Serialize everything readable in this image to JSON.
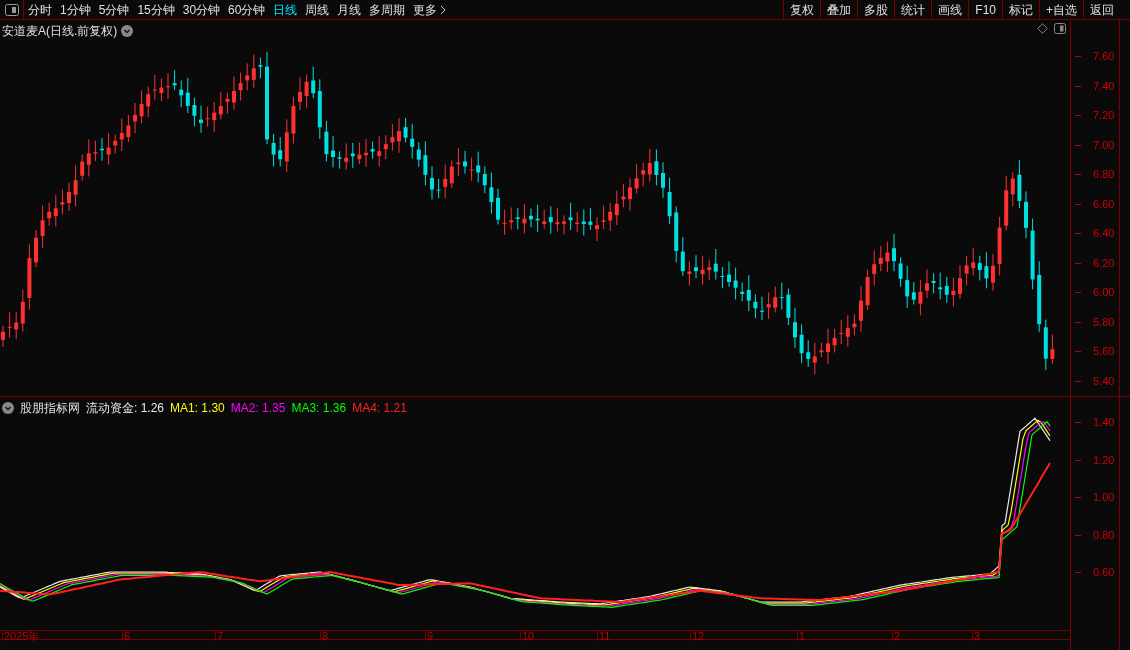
{
  "toolbar": {
    "periods": [
      {
        "label": "分时",
        "selected": false
      },
      {
        "label": "1分钟",
        "selected": false
      },
      {
        "label": "5分钟",
        "selected": false
      },
      {
        "label": "15分钟",
        "selected": false
      },
      {
        "label": "30分钟",
        "selected": false
      },
      {
        "label": "60分钟",
        "selected": false
      },
      {
        "label": "日线",
        "selected": true
      },
      {
        "label": "周线",
        "selected": false
      },
      {
        "label": "月线",
        "selected": false
      },
      {
        "label": "多周期",
        "selected": false
      },
      {
        "label": "更多",
        "selected": false
      }
    ],
    "actions": [
      "复权",
      "叠加",
      "多股",
      "统计",
      "画线",
      "F10",
      "标记",
      "+自选",
      "返回"
    ]
  },
  "main_chart": {
    "title": "安道麦A(日线.前复权)",
    "y_ticks": [
      "7.60",
      "7.40",
      "7.20",
      "7.00",
      "6.80",
      "6.60",
      "6.40",
      "6.20",
      "6.00",
      "5.80",
      "5.60",
      "5.40"
    ]
  },
  "indicator": {
    "name": "股朋指标网",
    "values": [
      {
        "label": "流动资金:",
        "value": "1.26",
        "color": "#e8e8e8"
      },
      {
        "label": "MA1:",
        "value": "1.30",
        "color": "#ffff00"
      },
      {
        "label": "MA2:",
        "value": "1.35",
        "color": "#ff00ff"
      },
      {
        "label": "MA3:",
        "value": "1.36",
        "color": "#00ff00"
      },
      {
        "label": "MA4:",
        "value": "1.21",
        "color": "#ff2020"
      }
    ],
    "y_ticks": [
      "1.40",
      "1.20",
      "1.00",
      "0.80",
      "0.60"
    ]
  },
  "date_axis": [
    "2025年",
    "6",
    "7",
    "8",
    "9",
    "10",
    "11",
    "12",
    "1",
    "2",
    "3"
  ]
}
